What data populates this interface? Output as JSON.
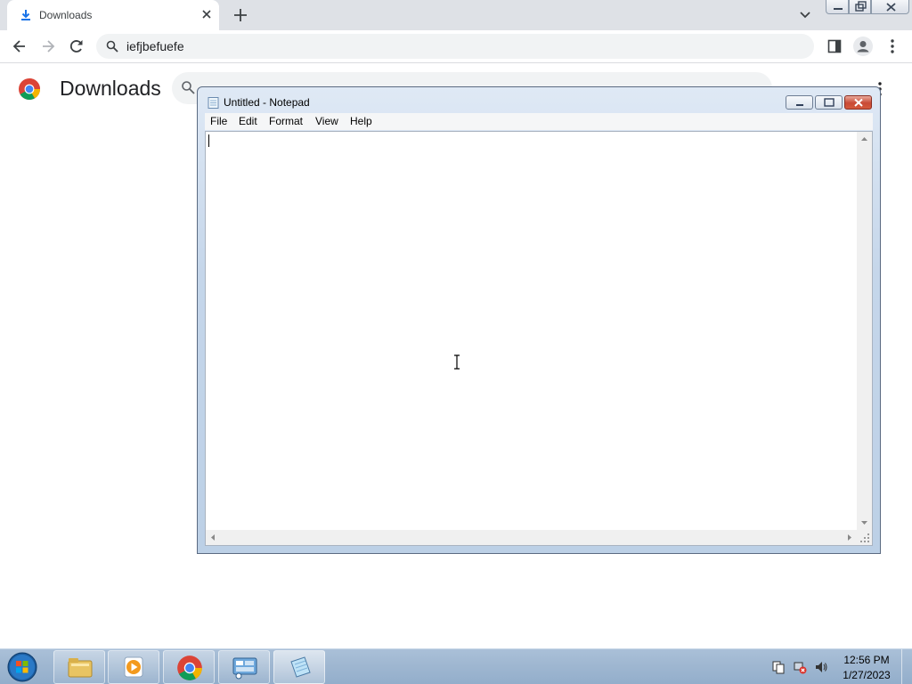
{
  "browser": {
    "tab": {
      "title": "Downloads",
      "favicon": "download-icon"
    },
    "omnibox": {
      "text": "iefjbefuefe"
    },
    "page": {
      "title": "Downloads",
      "search_placeholder": ""
    }
  },
  "notepad": {
    "title": "Untitled - Notepad",
    "menu": [
      "File",
      "Edit",
      "Format",
      "View",
      "Help"
    ],
    "content": ""
  },
  "taskbar": {
    "items": [
      "file-explorer",
      "media-player",
      "chrome",
      "control-panel",
      "notepad"
    ],
    "clock": {
      "time": "12:56 PM",
      "date": "1/27/2023"
    }
  },
  "colors": {
    "chrome_tabstrip": "#dee1e6",
    "chrome_blue": "#1a73e8",
    "taskbar": "#9fb7d1",
    "close_red": "#c94a35"
  }
}
